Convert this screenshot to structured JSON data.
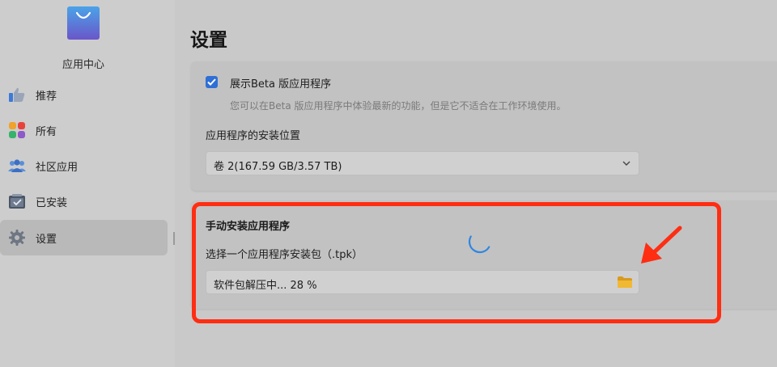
{
  "sidebar": {
    "app_name": "应用中心",
    "items": [
      {
        "label": "推荐",
        "icon": "thumbs-up-icon"
      },
      {
        "label": "所有",
        "icon": "apps-grid-icon"
      },
      {
        "label": "社区应用",
        "icon": "community-icon"
      },
      {
        "label": "已安装",
        "icon": "installed-box-icon"
      },
      {
        "label": "设置",
        "icon": "gear-icon",
        "active": true
      }
    ]
  },
  "main": {
    "title": "设置",
    "beta": {
      "checked": true,
      "label": "展示Beta 版应用程序",
      "description": "您可以在Beta 版应用程序中体验最新的功能，但是它不适合在工作环境使用。"
    },
    "install_location": {
      "label": "应用程序的安装位置",
      "selected": "卷 2(167.59 GB/3.57 TB)"
    },
    "manual_install": {
      "title": "手动安装应用程序",
      "package_label": "选择一个应用程序安装包（.tpk）",
      "progress_text": "软件包解压中... 28 %",
      "progress_percent": 28
    }
  },
  "colors": {
    "accent": "#2f6fd6",
    "annotation": "#ff2d12",
    "folder": "#e0a92a"
  }
}
